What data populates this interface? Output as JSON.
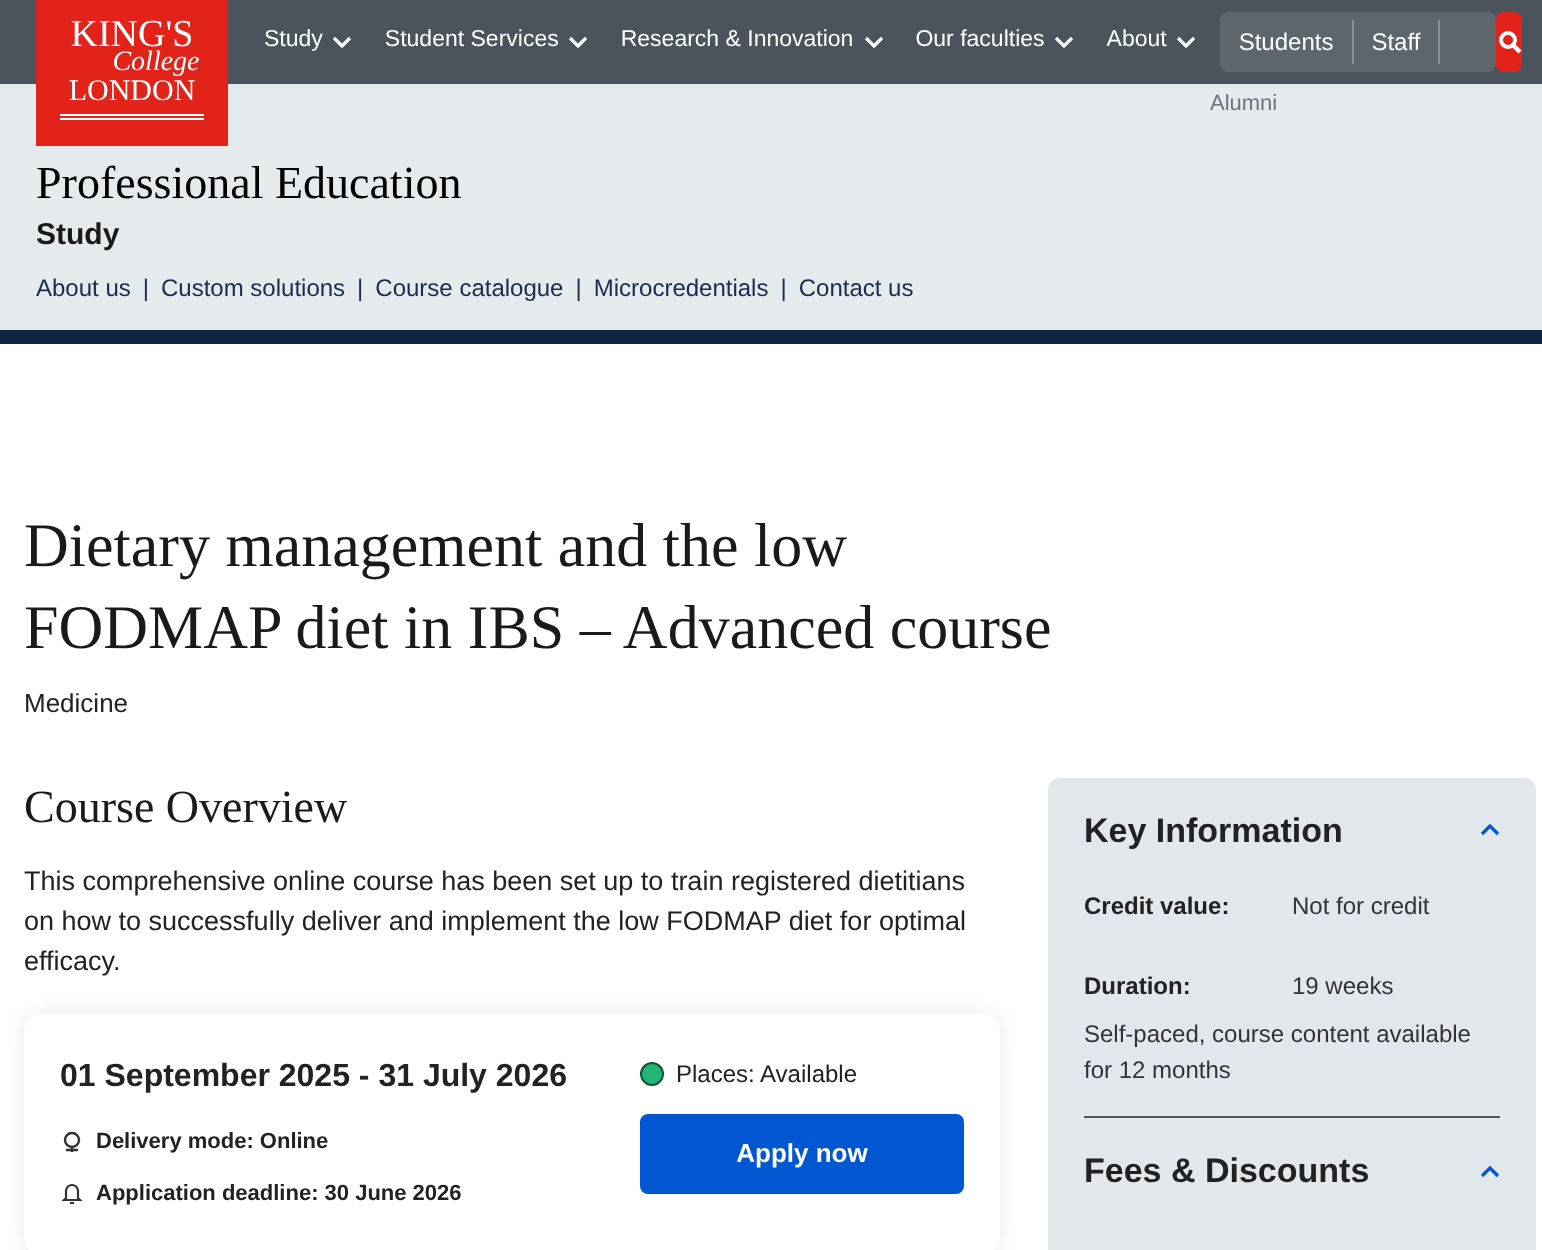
{
  "logo": {
    "line_1": "KING'S",
    "line_2": "College",
    "line_3": "LONDON"
  },
  "nav": {
    "items": [
      {
        "label": "Study"
      },
      {
        "label": "Student Services"
      },
      {
        "label": "Research & Innovation"
      },
      {
        "label": "Our faculties"
      },
      {
        "label": "About"
      }
    ],
    "audience_links": [
      "Students",
      "Staff"
    ],
    "overflow_link": "Alumni"
  },
  "section": {
    "title": "Professional Education",
    "subtitle": "Study",
    "links": [
      "About us",
      "Custom solutions",
      "Course catalogue",
      "Microcredentials",
      "Contact us"
    ],
    "separator": "|"
  },
  "course": {
    "title": "Dietary management and the low FODMAP diet in IBS – Advanced course",
    "faculty": "Medicine"
  },
  "overview": {
    "heading": "Course Overview",
    "text": "This comprehensive online course has been set up to train registered dietitians on how to successfully deliver and implement the low FODMAP diet for optimal efficacy."
  },
  "session": {
    "dates": "01 September 2025 - 31 July 2026",
    "delivery": "Delivery mode: Online",
    "deadline": "Application deadline: 30 June 2026",
    "status": {
      "label": "Places: Available",
      "color": "#22b573"
    },
    "apply": "Apply now"
  },
  "key_info": {
    "heading": "Key Information",
    "expanded": true,
    "rows": [
      {
        "label": "Credit value:",
        "value": "Not for credit"
      },
      {
        "label": "Duration:",
        "value": "19 weeks"
      }
    ],
    "note": "Self-paced, course content available for 12 months"
  },
  "fees": {
    "heading": "Fees & Discounts",
    "expanded": true
  }
}
